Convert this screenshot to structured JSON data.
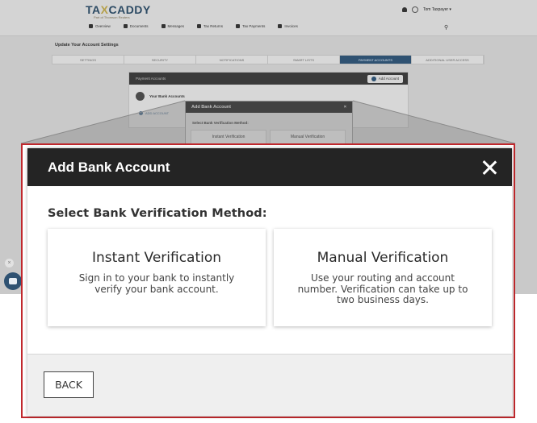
{
  "header": {
    "logo_main_pre": "TA",
    "logo_main_x": "X",
    "logo_main_post": "CADDY",
    "logo_sub": "Part of Thomson Reuters",
    "user_name": "Tom Taxpayer ▾"
  },
  "nav": {
    "items": [
      {
        "label": "Overview",
        "icon": "home-icon"
      },
      {
        "label": "Documents",
        "icon": "documents-icon"
      },
      {
        "label": "Messages",
        "icon": "messages-icon"
      },
      {
        "label": "Tax Returns",
        "icon": "tax-returns-icon"
      },
      {
        "label": "Tax Payments",
        "icon": "tax-payments-icon"
      },
      {
        "label": "Invoices",
        "icon": "invoices-icon"
      }
    ],
    "search_icon": "search-icon"
  },
  "settings": {
    "title": "Update Your Account Settings",
    "tabs": [
      {
        "label": "Settings",
        "active": false
      },
      {
        "label": "Security",
        "active": false
      },
      {
        "label": "Notifications",
        "active": false
      },
      {
        "label": "Smart Lists",
        "active": false
      },
      {
        "label": "Payment Accounts",
        "active": true
      },
      {
        "label": "Additional User Access",
        "active": false
      }
    ]
  },
  "payment_card": {
    "header": "Payment Accounts",
    "add_button": "Add Account",
    "bank_label": "Your Bank Accounts",
    "add_link": "ADD ACCOUNT"
  },
  "mini_modal": {
    "title": "Add Bank Account",
    "question": "Select Bank Verification Method:",
    "option_instant": "Instant Verification",
    "option_manual": "Manual Verification",
    "close": "×"
  },
  "modal": {
    "title": "Add Bank Account",
    "question": "Select Bank Verification Method:",
    "options": [
      {
        "title": "Instant Verification",
        "description": "Sign in to your bank to instantly verify your bank account."
      },
      {
        "title": "Manual Verification",
        "description": "Use your routing and account number. Verification can take up to two business days."
      }
    ],
    "back_button": "BACK"
  },
  "colors": {
    "modal_header": "#242424",
    "highlight_border": "#c0282d",
    "brand_navy": "#2f5272",
    "brand_gold": "#b5a04a"
  }
}
